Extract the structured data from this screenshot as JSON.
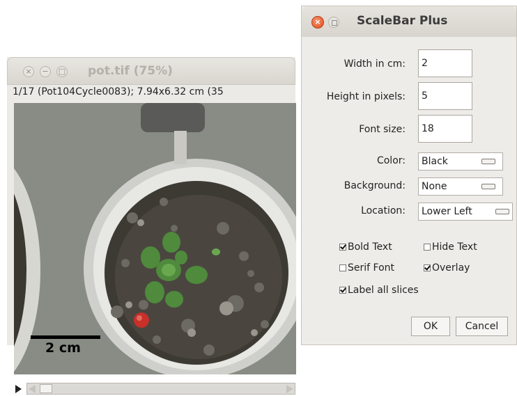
{
  "image_window": {
    "title": "pot.tif (75%)",
    "info": "1/17 (Pot104Cycle0083); 7.94x6.32 cm (35",
    "scale_bar_label": "2 cm"
  },
  "dialog": {
    "title": "ScaleBar Plus",
    "fields": {
      "width_label": "Width in cm:",
      "width_value": "2",
      "height_label": "Height in pixels:",
      "height_value": "5",
      "font_label": "Font size:",
      "font_value": "18"
    },
    "choices": {
      "color_label": "Color:",
      "color_value": "Black",
      "background_label": "Background:",
      "background_value": "None",
      "location_label": "Location:",
      "location_value": "Lower Left"
    },
    "checkboxes": {
      "bold_text": "Bold Text",
      "hide_text": "Hide Text",
      "serif_font": "Serif Font",
      "overlay": "Overlay",
      "label_all_slices": "Label all slices"
    },
    "buttons": {
      "ok": "OK",
      "cancel": "Cancel"
    }
  }
}
